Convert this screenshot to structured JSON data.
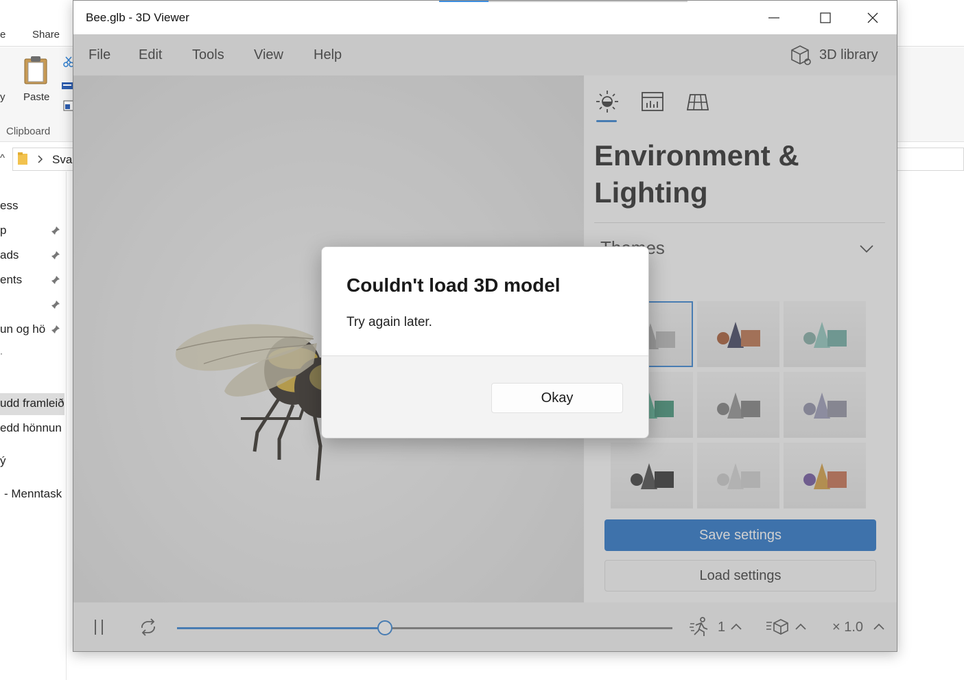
{
  "explorer": {
    "ribbon_tabs": [
      "e",
      "Share"
    ],
    "paste_label": "Paste",
    "y_label": "y",
    "group_label": "Clipboard",
    "address_text": "Sva",
    "nav_items": [
      {
        "label": "ess"
      },
      {
        "label": "p"
      },
      {
        "label": "ads"
      },
      {
        "label": "ents"
      },
      {
        "label": ""
      },
      {
        "label": "un og hö"
      },
      {
        "label": "udd framleið"
      },
      {
        "label": "edd hönnun"
      },
      {
        "label": "ý"
      },
      {
        "label": "- Menntask"
      }
    ]
  },
  "viewer": {
    "title": "Bee.glb - 3D Viewer",
    "menu": [
      "File",
      "Edit",
      "Tools",
      "View",
      "Help"
    ],
    "library_label": "3D library",
    "panel": {
      "title": "Environment & Lighting",
      "section": "Themes",
      "save_label": "Save settings",
      "load_label": "Load settings"
    },
    "bottom": {
      "speed_value": "1",
      "scale_value": "× 1.0",
      "timeline_progress": 0.42
    }
  },
  "dialog": {
    "title": "Couldn't load 3D model",
    "message": "Try again later.",
    "ok_label": "Okay"
  },
  "colors": {
    "accent": "#2f7fd1",
    "save_button": "#1f6fc7"
  }
}
